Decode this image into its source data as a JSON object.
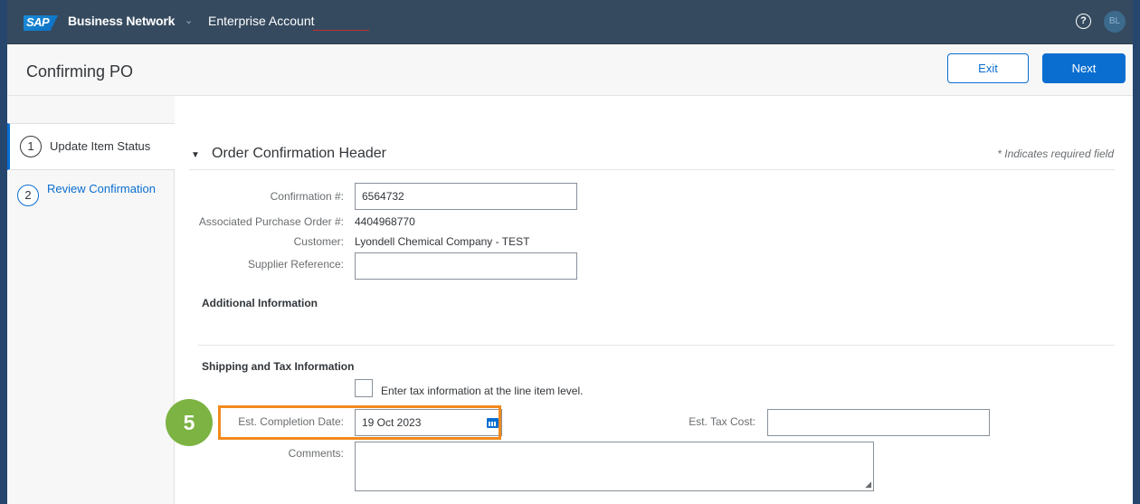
{
  "shell": {
    "logo": "SAP",
    "product": "Business Network",
    "product_chevron": "⌄",
    "account": "Enterprise Account",
    "help_icon": "?",
    "avatar": "BL"
  },
  "header": {
    "title": "Confirming PO",
    "exit_label": "Exit",
    "next_label": "Next"
  },
  "steps": [
    {
      "number": "1",
      "label": "Update Item Status"
    },
    {
      "number": "2",
      "label": "Review Confirmation"
    }
  ],
  "section": {
    "caret": "▼",
    "title": "Order Confirmation Header",
    "required_note": "* Indicates required field"
  },
  "fields": {
    "confirmation_label": "Confirmation #:",
    "confirmation_value": "6564732",
    "po_label": "Associated Purchase Order #:",
    "po_value": "4404968770",
    "customer_label": "Customer:",
    "customer_value": "Lyondell Chemical Company - TEST",
    "supplier_ref_label": "Supplier Reference:",
    "supplier_ref_value": ""
  },
  "additional": {
    "heading": "Additional Information"
  },
  "shipping": {
    "heading": "Shipping and Tax Information",
    "tax_checkbox_label": "Enter tax information at the line item level.",
    "completion_label": "Est. Completion Date:",
    "completion_value": "19 Oct 2023",
    "tax_cost_label": "Est. Tax Cost:",
    "tax_cost_value": "",
    "comments_label": "Comments:"
  },
  "annotation": {
    "step_number": "5",
    "badge_color": "#7cb342",
    "highlight_color": "#f18a1d"
  },
  "colors": {
    "shell": "#354a5f",
    "accent": "#0a6ed1"
  }
}
